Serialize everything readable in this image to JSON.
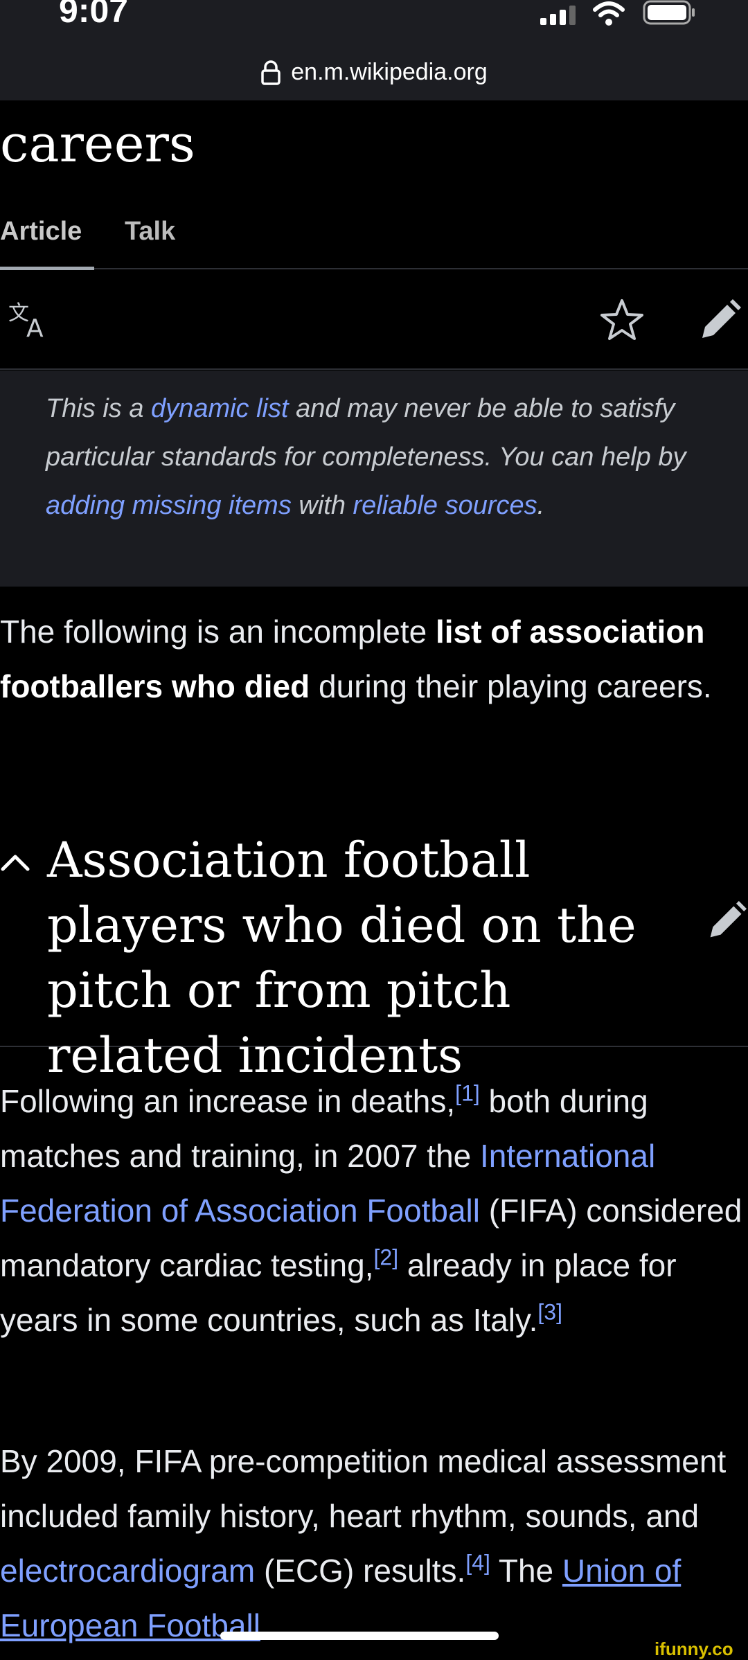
{
  "status_bar": {
    "time": "9:07",
    "url": "en.m.wikipedia.org"
  },
  "page": {
    "title_partial": "careers"
  },
  "tabs": [
    {
      "label": "Article",
      "active": true
    },
    {
      "label": "Talk",
      "active": false
    }
  ],
  "toolbar": {
    "icons": [
      "language-icon",
      "star-icon",
      "edit-icon"
    ]
  },
  "notice": {
    "t1": "This is a ",
    "l1": "dynamic list",
    "t2": " and may never be able to satisfy particular standards for completeness. You can help by ",
    "l2": "adding missing items",
    "t3": " with ",
    "l3": "reliable sources",
    "t4": "."
  },
  "intro": {
    "t1": "The following is an incomplete ",
    "bold": "list of association footballers who died",
    "t2": " during their playing careers."
  },
  "section": {
    "title": "Association football players who died on the pitch or from pitch related incidents"
  },
  "para1": {
    "t1": "Following an increase in deaths,",
    "r1": "[1]",
    "t2": " both during matches and training, in 2007 the ",
    "l1": "International Federation of Association Football",
    "t3": " (FIFA) considered mandatory cardiac testing,",
    "r2": "[2]",
    "t4": " already in place for years in some countries, such as Italy.",
    "r3": "[3]"
  },
  "para2": {
    "t1": "By 2009, FIFA pre-competition medical assessment included family history, heart rhythm, sounds, and ",
    "l1": "electrocardiogram",
    "t2": " (ECG) results.",
    "r1": "[4]",
    "t3": " The ",
    "l2": "Union of European Football"
  },
  "watermark": "ifunny.co",
  "colors": {
    "background": "#000000",
    "link": "#7fa0ff",
    "notice_bg": "#1b1c21",
    "status_bg": "#1c1d22"
  }
}
